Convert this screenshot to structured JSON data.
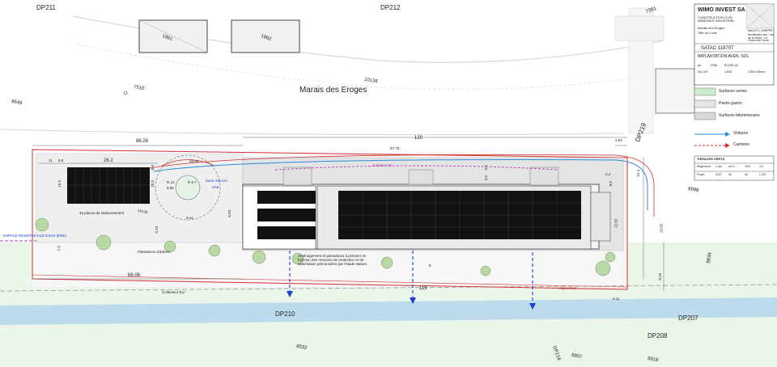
{
  "parcels": {
    "dp211": "DP211",
    "dp212": "DP212",
    "dp210": "DP210",
    "dp207": "DP207",
    "dp208": "DP208",
    "dp219": "DP219",
    "dp218": "DP218",
    "b1861": "1861",
    "b1862": "1862",
    "p10136": "10136",
    "p10135": "10135",
    "p7391": "7391",
    "p7510": "7510",
    "p8649": "8649",
    "p8998": "8998",
    "p8532": "8532",
    "p6807": "6807",
    "p6618": "6618",
    "p8834": "8834"
  },
  "place": {
    "marais": "Marais des Eroges",
    "collecteur": "Collecteur EU",
    "espace_eaux": "ESPACE RESERVE AUX EAUX (ERE)",
    "alignement": "Alignement",
    "plantations": "Plantations d'arbres",
    "zone_acces": "Zone d'acces",
    "zae": "ZAE",
    "gabarit": "Gabarit 7.50",
    "parking": "46 places de stationnement",
    "note": "Aménagement et plantations à préciser en fonction des mesures de protection et de valorisation préconisées par l'étude Nature.",
    "sentier": "sentier"
  },
  "dims": {
    "d8626": "86.26",
    "d120": "120",
    "d9775": "97.75",
    "d453": "4.53",
    "d262": "26.2",
    "d2906": "29.06",
    "d11": "11",
    "d88a": "8.8",
    "d102a": "10.2",
    "d102b": "10.2",
    "d88b": "8.8",
    "d1a": "1",
    "d16a": "16",
    "d55": "5.5",
    "d35": "3.5",
    "d22": "2.2",
    "d88c": "8.8",
    "d124": "12.4",
    "d2282a": "22.82",
    "d2282b": "22.82",
    "d829": "8.29",
    "d611": "6.11",
    "d119": "119",
    "d6606": "66.06",
    "d14": "1.4",
    "d8": "8",
    "d1b": "1",
    "d923": "9.23",
    "d914": "9.14",
    "d693": "6.93",
    "d696": "6.96",
    "r12": "R 12",
    "r67": "R 6.7",
    "d82": "8.2",
    "d20": "2.0"
  },
  "title_block": {
    "company": "WIMO INVEST SA",
    "project": "CONSTRUCTION D'UN IMMEUBLE INDUSTRIEL",
    "location_1": "Marais des Eroges",
    "location_2": "Ville du Locle",
    "ref": "SATAC 119707",
    "drawing": "IMPLANTATION AVEN. SOL",
    "architect": "MACHT | ZIMPPE",
    "architect_sub": "architectes sàrl · rue de la Serre · La Chaux-de-Fonds",
    "phase": "ph",
    "format": "FRM",
    "echelle": "ÉCHELLE",
    "scale": "1:500",
    "num": "DA 100",
    "date": "CSM 8 Bva c"
  },
  "legend": {
    "vertes": "Surfaces vertes",
    "pave": "Pavés gazon",
    "bitum": "Surfaces bitumineuses",
    "voitures": "Voitures",
    "camions": "Camions",
    "table_title": "ESPACES VERTS",
    "table_headers": [
      "Règlement",
      "1 dal",
      "m2 s",
      "10%",
      "1/4"
    ],
    "table_row": [
      "Projet",
      "2237",
      "92",
      "46",
      "≤ 119"
    ]
  },
  "colors": {
    "green": "#cdeccd",
    "pave": "#e6e6e6",
    "bitum": "#d8d8d8",
    "water": "#b8d8ec",
    "car": "#2a8bd8",
    "truck": "#d33030",
    "magenta": "#b040b0",
    "solar": "#111111"
  }
}
